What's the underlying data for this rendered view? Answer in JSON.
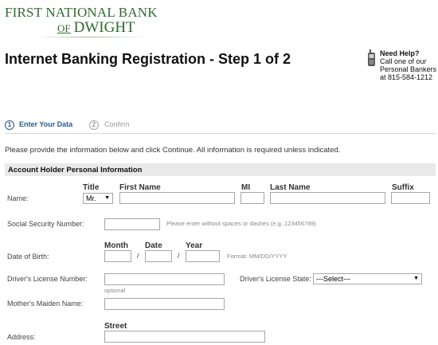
{
  "brand": {
    "line1": "FIRST NATIONAL BANK",
    "of": "OF",
    "line2": "DWIGHT"
  },
  "page_title": "Internet Banking Registration - Step 1 of 2",
  "help": {
    "title": "Need Help?",
    "text": "Call one of our Personal Bankers at 815-584-1212",
    "icon": "phone-icon"
  },
  "steps": [
    {
      "number": "1",
      "label": "Enter Your Data",
      "active": true
    },
    {
      "number": "2",
      "label": "Confirm",
      "active": false
    }
  ],
  "instructions": "Please provide the information below and click Continue. All information is required unless indicated.",
  "section_title": "Account Holder Personal Information",
  "form": {
    "name": {
      "label": "Name:",
      "title_header": "Title",
      "title_value": "Mr.",
      "first_header": "First Name",
      "mi_header": "MI",
      "last_header": "Last Name",
      "suffix_header": "Suffix"
    },
    "ssn": {
      "label": "Social Security Number:",
      "hint": "Please enter without spaces or dashes (e.g.,123456789)"
    },
    "dob": {
      "label": "Date of Birth:",
      "month_header": "Month",
      "date_header": "Date",
      "year_header": "Year",
      "separator": "/",
      "format_hint": "Format: MM/DD/YYYY"
    },
    "license": {
      "label": "Driver's License Number:",
      "optional": "optional",
      "state_label": "Driver's License State:",
      "state_value": "---Select---"
    },
    "maiden": {
      "label": "Mother's Maiden Name:"
    },
    "address": {
      "label": "Address:",
      "street_header": "Street"
    }
  },
  "colors": {
    "brand_green": "#2e6b2e",
    "step_active": "#2a5d8a",
    "section_bg": "#e9e9e9"
  }
}
